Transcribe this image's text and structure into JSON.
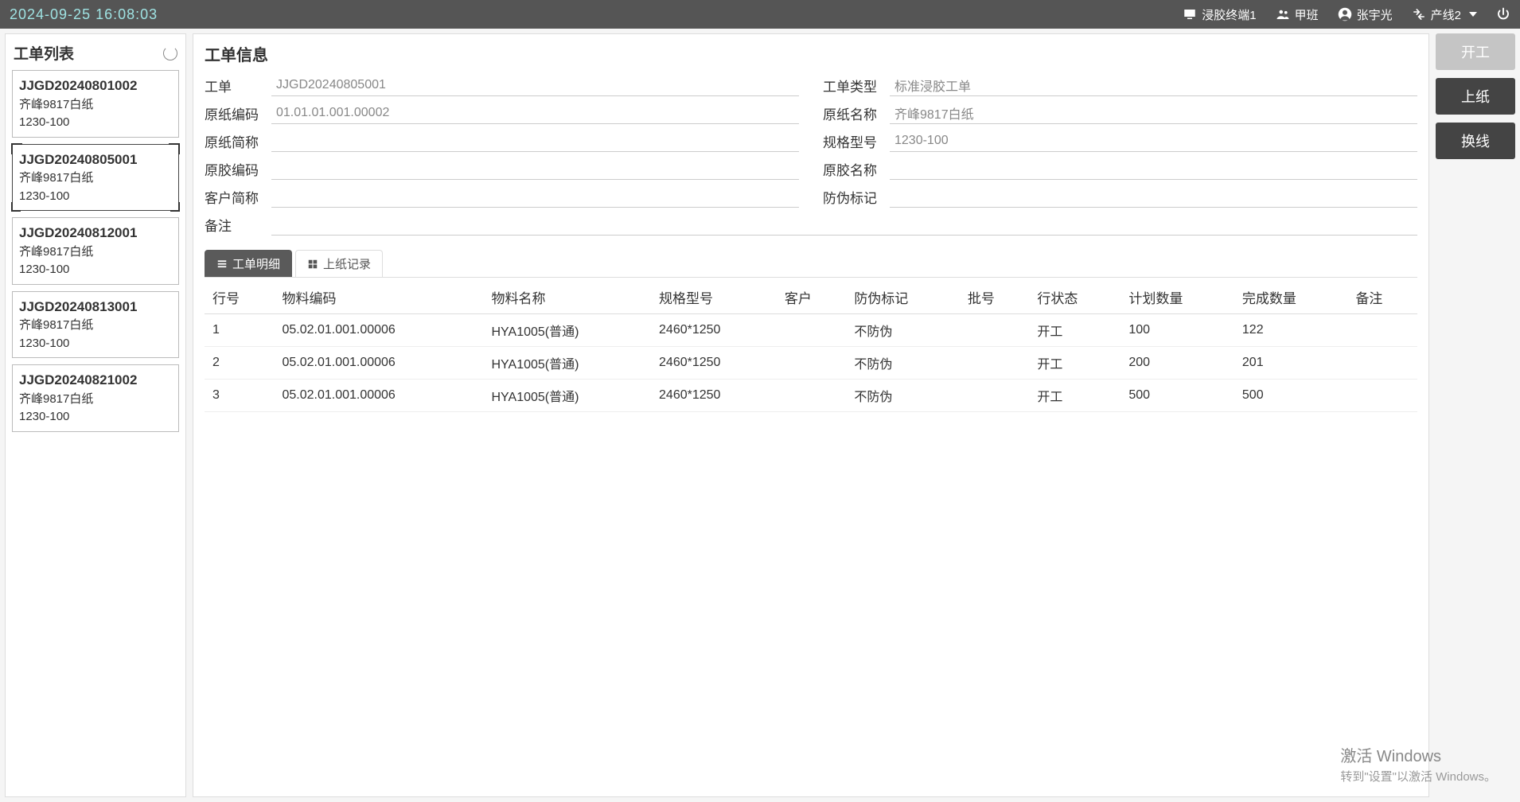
{
  "topbar": {
    "datetime": "2024-09-25 16:08:03",
    "terminal": "浸胶终端1",
    "shift": "甲班",
    "user": "张宇光",
    "line": "产线2"
  },
  "sidebar": {
    "title": "工单列表",
    "orders": [
      {
        "id": "JJGD20240801002",
        "paper": "齐峰9817白纸",
        "spec": "1230-100",
        "selected": false
      },
      {
        "id": "JJGD20240805001",
        "paper": "齐峰9817白纸",
        "spec": "1230-100",
        "selected": true
      },
      {
        "id": "JJGD20240812001",
        "paper": "齐峰9817白纸",
        "spec": "1230-100",
        "selected": false
      },
      {
        "id": "JJGD20240813001",
        "paper": "齐峰9817白纸",
        "spec": "1230-100",
        "selected": false
      },
      {
        "id": "JJGD20240821002",
        "paper": "齐峰9817白纸",
        "spec": "1230-100",
        "selected": false
      }
    ]
  },
  "info": {
    "title": "工单信息",
    "labels": {
      "order": "工单",
      "order_type": "工单类型",
      "paper_code": "原纸编码",
      "paper_name": "原纸名称",
      "paper_short": "原纸简称",
      "spec": "规格型号",
      "glue_code": "原胶编码",
      "glue_name": "原胶名称",
      "cust_short": "客户简称",
      "anti_fake": "防伪标记",
      "remark": "备注"
    },
    "values": {
      "order": "JJGD20240805001",
      "order_type": "标准浸胶工单",
      "paper_code": "01.01.01.001.00002",
      "paper_name": "齐峰9817白纸",
      "paper_short": "",
      "spec": "1230-100",
      "glue_code": "",
      "glue_name": "",
      "cust_short": "",
      "anti_fake": "",
      "remark": ""
    }
  },
  "tabs": {
    "detail": "工单明细",
    "paperlog": "上纸记录"
  },
  "table": {
    "headers": [
      "行号",
      "物料编码",
      "物料名称",
      "规格型号",
      "客户",
      "防伪标记",
      "批号",
      "行状态",
      "计划数量",
      "完成数量",
      "备注"
    ],
    "rows": [
      {
        "lineno": "1",
        "matcode": "05.02.01.001.00006",
        "matname": "HYA1005(普通)",
        "spec": "2460*1250",
        "cust": "",
        "anti": "不防伪",
        "batch": "",
        "status": "开工",
        "plan": "100",
        "done": "122",
        "remark": ""
      },
      {
        "lineno": "2",
        "matcode": "05.02.01.001.00006",
        "matname": "HYA1005(普通)",
        "spec": "2460*1250",
        "cust": "",
        "anti": "不防伪",
        "batch": "",
        "status": "开工",
        "plan": "200",
        "done": "201",
        "remark": ""
      },
      {
        "lineno": "3",
        "matcode": "05.02.01.001.00006",
        "matname": "HYA1005(普通)",
        "spec": "2460*1250",
        "cust": "",
        "anti": "不防伪",
        "batch": "",
        "status": "开工",
        "plan": "500",
        "done": "500",
        "remark": ""
      }
    ]
  },
  "actions": {
    "start": "开工",
    "loadpaper": "上纸",
    "changeline": "换线"
  },
  "watermark": {
    "title": "激活 Windows",
    "sub": "转到\"设置\"以激活 Windows。"
  }
}
